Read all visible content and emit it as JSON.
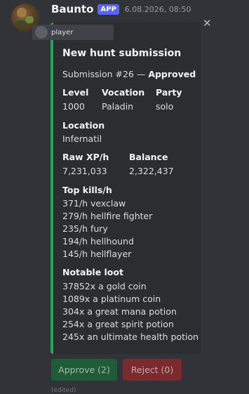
{
  "message": {
    "username": "Baunto",
    "app_badge": "APP",
    "timestamp": "6.08.2026, 08:50",
    "edited_label": "(edited)"
  },
  "embed": {
    "accent_color": "#23a55a",
    "author_name": "player",
    "close_glyph": "✕",
    "title": "New hunt submission",
    "description_prefix": "Submission #26 — ",
    "status": "Approved",
    "fields": {
      "level": {
        "name": "Level",
        "value": "1000"
      },
      "vocation": {
        "name": "Vocation",
        "value": "Paladin"
      },
      "party": {
        "name": "Party",
        "value": "solo"
      },
      "location": {
        "name": "Location",
        "value": "Infernatil"
      },
      "raw_xp": {
        "name": "Raw XP/h",
        "value": "7,231,033"
      },
      "balance": {
        "name": "Balance",
        "value": "2,322,437"
      }
    },
    "top_kills": {
      "name": "Top kills/h",
      "items": [
        "371/h vexclaw",
        "279/h hellfire fighter",
        "235/h fury",
        "194/h hellhound",
        "145/h hellflayer"
      ]
    },
    "notable_loot": {
      "name": "Notable loot",
      "items": [
        "37852x a gold coin",
        "1089x a platinum coin",
        "304x a great mana potion",
        "254x a great spirit potion",
        "245x an ultimate health potion"
      ]
    }
  },
  "buttons": {
    "approve_label": "Approve (2)",
    "reject_label": "Reject (0)",
    "approve_color": "#1f5c38",
    "reject_color": "#7b2b2e"
  },
  "icons": {
    "avatar": "avatar-icon",
    "close": "close-icon"
  }
}
